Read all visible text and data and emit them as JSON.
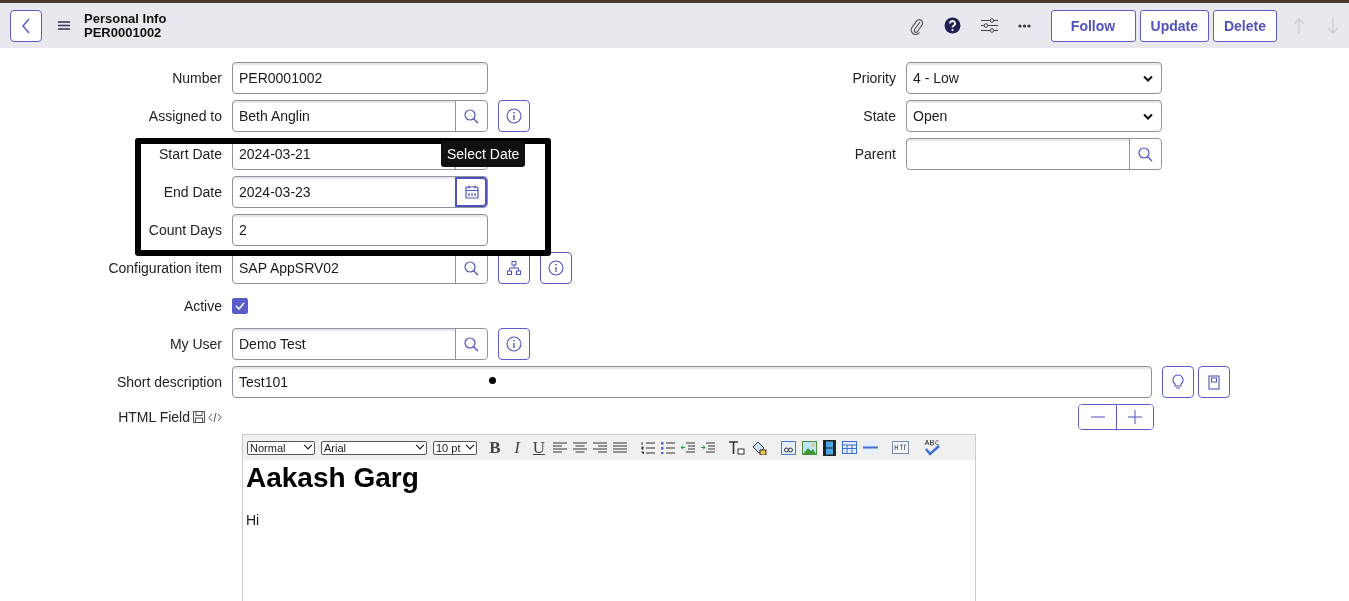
{
  "header": {
    "title": "Personal Info",
    "subtitle": "PER0001002",
    "buttons": [
      {
        "label": "Follow"
      },
      {
        "label": "Update"
      },
      {
        "label": "Delete"
      }
    ],
    "nav": [
      {
        "kind": "up",
        "disabled": true
      },
      {
        "kind": "down",
        "disabled": true
      }
    ]
  },
  "left_fields": [
    {
      "label": "Number",
      "kind": "text",
      "value": "PER0001002"
    },
    {
      "label": "Assigned to",
      "kind": "reference",
      "value": "Beth Anglin",
      "actions": [
        {
          "kind": "info"
        }
      ]
    },
    {
      "label": "Start Date",
      "kind": "date",
      "value": "2024-03-21",
      "focused": false
    },
    {
      "label": "End Date",
      "kind": "date",
      "value": "2024-03-23",
      "focused": true
    },
    {
      "label": "Count Days",
      "kind": "text",
      "value": "2"
    },
    {
      "label": "Configuration item",
      "kind": "reference",
      "value": "SAP AppSRV02",
      "actions": [
        {
          "kind": "tree"
        },
        {
          "kind": "info"
        }
      ]
    }
  ],
  "tooltip": "Select Date",
  "right_fields": [
    {
      "label": "Priority",
      "kind": "select",
      "value": "4 - Low"
    },
    {
      "label": "State",
      "kind": "select",
      "value": "Open"
    },
    {
      "label": "Parent",
      "kind": "reference"
    }
  ],
  "active": {
    "label": "Active",
    "checked": true
  },
  "my_user": {
    "label": "My User",
    "value": "Demo Test"
  },
  "short_description": {
    "label": "Short description",
    "value": "Test101"
  },
  "html_field": {
    "label": "HTML Field",
    "format": "Normal",
    "font": "Arial",
    "size": "10 pt",
    "bold": "B",
    "italic": "I",
    "underline": "U",
    "heading": "Aakash Garg",
    "body": "Hi"
  }
}
